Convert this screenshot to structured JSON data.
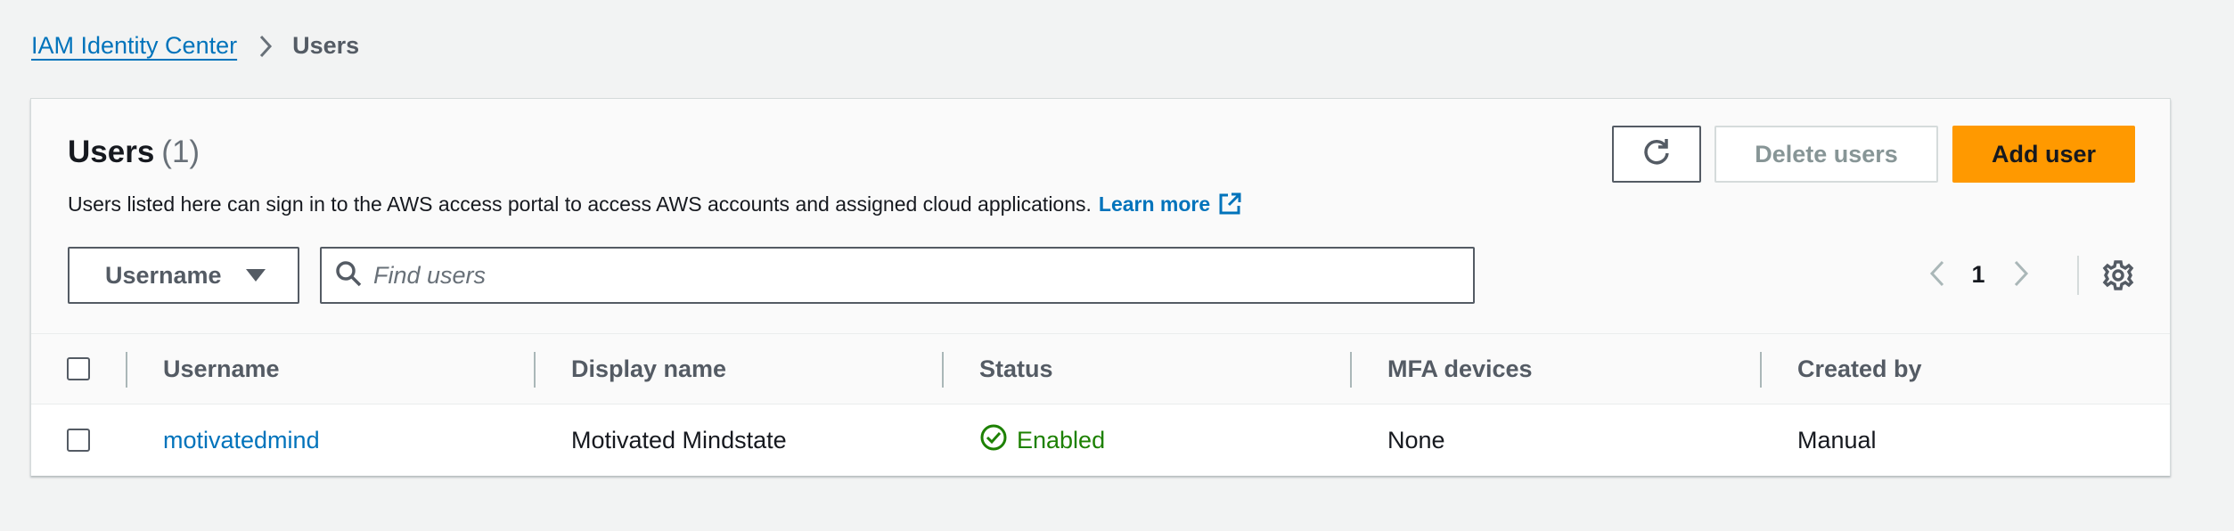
{
  "breadcrumb": {
    "parent": "IAM Identity Center",
    "current": "Users"
  },
  "panel": {
    "title": "Users",
    "count": "(1)",
    "description": "Users listed here can sign in to the AWS access portal to access AWS accounts and assigned cloud applications.",
    "learn_more": "Learn more",
    "buttons": {
      "delete": "Delete users",
      "add": "Add user"
    }
  },
  "filter": {
    "property_select": "Username",
    "search_placeholder": "Find users"
  },
  "pagination": {
    "current_page": "1"
  },
  "table": {
    "columns": [
      "Username",
      "Display name",
      "Status",
      "MFA devices",
      "Created by"
    ],
    "rows": [
      {
        "username": "motivatedmind",
        "display_name": "Motivated Mindstate",
        "status": "Enabled",
        "mfa_devices": "None",
        "created_by": "Manual"
      }
    ]
  },
  "colors": {
    "primary": "#ff9900",
    "link": "#0073bb",
    "success": "#1d8102",
    "background": "#f2f3f3"
  },
  "icons": [
    "chevron-right-icon",
    "external-link-icon",
    "refresh-icon",
    "caret-down-icon",
    "search-icon",
    "chevron-left-icon",
    "gear-icon",
    "status-success-icon"
  ]
}
